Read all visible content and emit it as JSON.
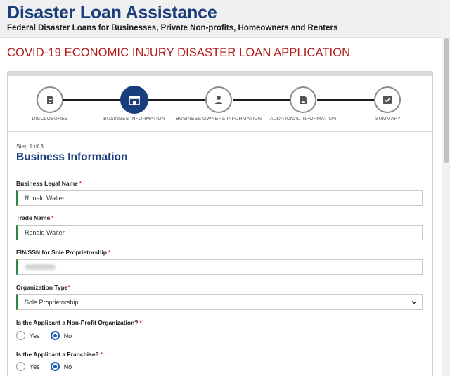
{
  "header": {
    "title": "Disaster Loan Assistance",
    "subtitle": "Federal Disaster Loans for Businesses, Private Non-profits, Homeowners and Renters"
  },
  "page": {
    "title": "COVID-19 ECONOMIC INJURY DISASTER LOAN APPLICATION"
  },
  "stepper": {
    "active_index": 1,
    "steps": [
      {
        "label": "DISCLOSURES",
        "icon": "document-icon"
      },
      {
        "label": "BUSINESS INFORMATION",
        "icon": "storefront-icon"
      },
      {
        "label": "BUSINESS OWNERS INFORMATION",
        "icon": "person-icon"
      },
      {
        "label": "ADDITIONAL INFORMATION",
        "icon": "image-document-icon"
      },
      {
        "label": "SUMMARY",
        "icon": "checkbox-icon"
      }
    ]
  },
  "form": {
    "step_counter": "Step 1 of 3",
    "section_title": "Business Information",
    "business_legal_name": {
      "label": "Business Legal Name",
      "required": "*",
      "value": "Ronald Walter"
    },
    "trade_name": {
      "label": "Trade Name",
      "required": "*",
      "value": "Ronald Walter"
    },
    "ein_ssn": {
      "label": "EIN/SSN for Sole Proprietorship",
      "required": "*"
    },
    "organization_type": {
      "label": "Organization Type",
      "required": "*",
      "value": "Sole Proprietorship"
    },
    "non_profit": {
      "label": "Is the Applicant a Non-Profit Organization?",
      "required": "*",
      "options": [
        "Yes",
        "No"
      ],
      "selected": "No"
    },
    "franchise": {
      "label": "Is the Applicant a Franchise?",
      "required": "*",
      "options": [
        "Yes",
        "No"
      ],
      "selected": "No"
    }
  },
  "colors": {
    "brand_blue": "#1a3d7c",
    "title_red": "#b21d1d",
    "valid_green": "#2e8540",
    "radio_blue": "#1a5fb4"
  }
}
